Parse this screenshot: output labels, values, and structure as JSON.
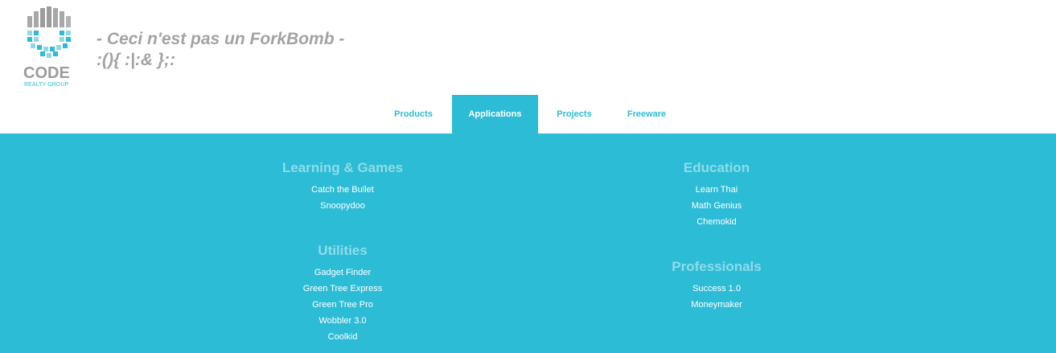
{
  "logo": {
    "word": "CODE",
    "sub": "REALTY GROUP",
    "icon": "building-grid-logo",
    "colors": {
      "gray": "#9c9c9c",
      "cyan": "#2dbcd6",
      "light_cyan": "#8ed8e8"
    }
  },
  "tagline": {
    "line1": "- Ceci n'est pas un ForkBomb -",
    "line2": ":(){ :|:& };:"
  },
  "nav": {
    "items": [
      {
        "label": "Products"
      },
      {
        "label": "Applications"
      },
      {
        "label": "Projects"
      },
      {
        "label": "Freeware"
      }
    ],
    "active": "Applications"
  },
  "menu": {
    "left": [
      {
        "title": "Learning & Games",
        "links": [
          "Catch the Bullet",
          "Snoopydoo"
        ]
      },
      {
        "title": "Utilities",
        "links": [
          "Gadget Finder",
          "Green Tree Express",
          "Green Tree Pro",
          "Wobbler 3.0",
          "Coolkid"
        ]
      }
    ],
    "right": [
      {
        "title": "Education",
        "links": [
          "Learn Thai",
          "Math Genius",
          "Chemokid"
        ]
      },
      {
        "title": "Professionals",
        "links": [
          "Success 1.0",
          "Moneymaker"
        ]
      }
    ]
  },
  "colors": {
    "accent": "#2dbcd6",
    "heading_light": "#8edcea",
    "tagline_gray": "#a3a3a3"
  }
}
